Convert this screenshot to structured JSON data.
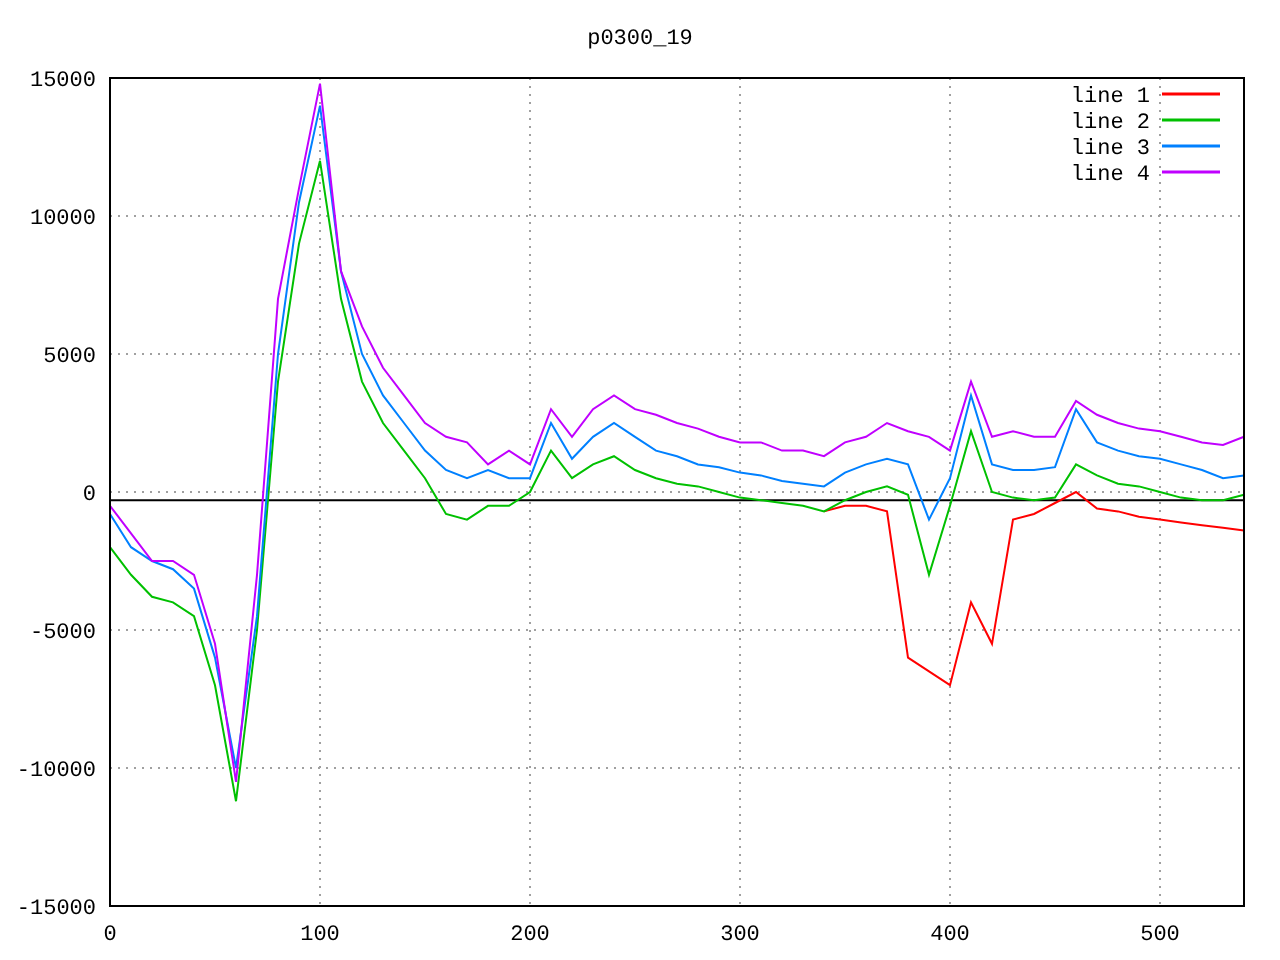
{
  "chart_data": {
    "type": "line",
    "title": "p0300_19",
    "xlim": [
      0,
      540
    ],
    "ylim": [
      -15000,
      15000
    ],
    "xticks": [
      0,
      100,
      200,
      300,
      400,
      500
    ],
    "yticks": [
      -15000,
      -10000,
      -5000,
      0,
      5000,
      10000,
      15000
    ],
    "x": [
      0,
      10,
      20,
      30,
      40,
      50,
      60,
      70,
      80,
      90,
      100,
      110,
      120,
      130,
      140,
      150,
      160,
      170,
      180,
      190,
      200,
      210,
      220,
      230,
      240,
      250,
      260,
      270,
      280,
      290,
      300,
      310,
      320,
      330,
      340,
      350,
      360,
      370,
      380,
      390,
      400,
      410,
      420,
      430,
      440,
      450,
      460,
      470,
      480,
      490,
      500,
      510,
      520,
      530,
      540
    ],
    "series": [
      {
        "name": "line 1",
        "color": "#ff0000",
        "values": [
          null,
          null,
          null,
          null,
          null,
          null,
          null,
          null,
          null,
          null,
          null,
          null,
          null,
          null,
          null,
          null,
          null,
          null,
          null,
          null,
          null,
          null,
          null,
          null,
          null,
          null,
          null,
          null,
          null,
          null,
          null,
          null,
          null,
          null,
          -700,
          -500,
          -500,
          -700,
          -6000,
          -6500,
          -7000,
          -4000,
          -5500,
          -1000,
          -800,
          -400,
          0,
          -600,
          -700,
          -900,
          -1000,
          -1100,
          -1200,
          -1300,
          -1400
        ]
      },
      {
        "name": "line 2",
        "color": "#00c000",
        "values": [
          -2000,
          -3000,
          -3800,
          -4000,
          -4500,
          -7000,
          -11200,
          -5000,
          4000,
          9000,
          12000,
          7000,
          4000,
          2500,
          1500,
          500,
          -800,
          -1000,
          -500,
          -500,
          0,
          1500,
          500,
          1000,
          1300,
          800,
          500,
          300,
          200,
          0,
          -200,
          -300,
          -400,
          -500,
          -700,
          -300,
          0,
          200,
          -100,
          -3000,
          -500,
          2200,
          0,
          -200,
          -300,
          -200,
          1000,
          600,
          300,
          200,
          0,
          -200,
          -300,
          -300,
          -100
        ]
      },
      {
        "name": "line 3",
        "color": "#0080ff",
        "values": [
          -800,
          -2000,
          -2500,
          -2800,
          -3500,
          -6000,
          -10000,
          -4500,
          5000,
          10500,
          14000,
          8000,
          5000,
          3500,
          2500,
          1500,
          800,
          500,
          800,
          500,
          500,
          2500,
          1200,
          2000,
          2500,
          2000,
          1500,
          1300,
          1000,
          900,
          700,
          600,
          400,
          300,
          200,
          700,
          1000,
          1200,
          1000,
          -1000,
          500,
          3500,
          1000,
          800,
          800,
          900,
          3000,
          1800,
          1500,
          1300,
          1200,
          1000,
          800,
          500,
          600
        ]
      },
      {
        "name": "line 4",
        "color": "#c000ff",
        "values": [
          -500,
          -1500,
          -2500,
          -2500,
          -3000,
          -5500,
          -10500,
          -3000,
          7000,
          11000,
          14800,
          8000,
          6000,
          4500,
          3500,
          2500,
          2000,
          1800,
          1000,
          1500,
          1000,
          3000,
          2000,
          3000,
          3500,
          3000,
          2800,
          2500,
          2300,
          2000,
          1800,
          1800,
          1500,
          1500,
          1300,
          1800,
          2000,
          2500,
          2200,
          2000,
          1500,
          4000,
          2000,
          2200,
          2000,
          2000,
          3300,
          2800,
          2500,
          2300,
          2200,
          2000,
          1800,
          1700,
          2000
        ]
      }
    ],
    "ref_lines": [
      {
        "axis": "y",
        "value": -300
      }
    ],
    "grid": true,
    "legend": true
  }
}
